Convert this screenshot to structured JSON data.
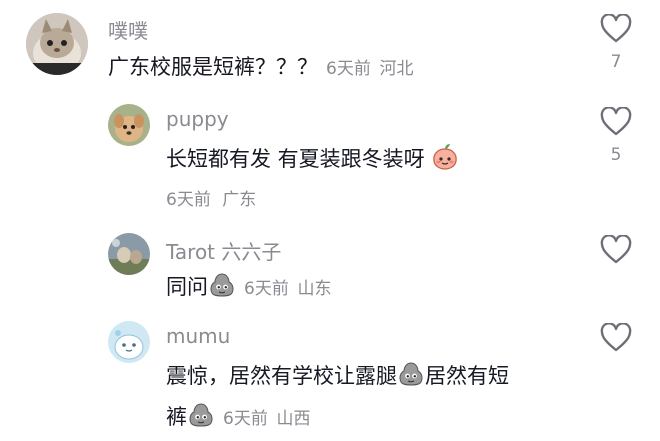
{
  "comments": [
    {
      "username": "噗噗",
      "text": "广东校服是短裤？？？",
      "time": "6天前",
      "location": "河北",
      "likes": "7"
    },
    {
      "username": "puppy",
      "text": "长短都有发 有夏装跟冬装呀",
      "time": "6天前",
      "location": "广东",
      "likes": "5",
      "emoji": "peach-face-emoji"
    },
    {
      "username": "Tarot 六六子",
      "text": "同问",
      "time": "6天前",
      "location": "山东",
      "likes": "",
      "emoji": "gray-blob-emoji"
    },
    {
      "username": "mumu",
      "text_line1_a": "震惊，居然有学校让露腿",
      "text_line1_b": "居然有短",
      "text_line2": "裤",
      "time": "6天前",
      "location": "山西",
      "likes": "",
      "emoji": "gray-blob-emoji"
    }
  ]
}
